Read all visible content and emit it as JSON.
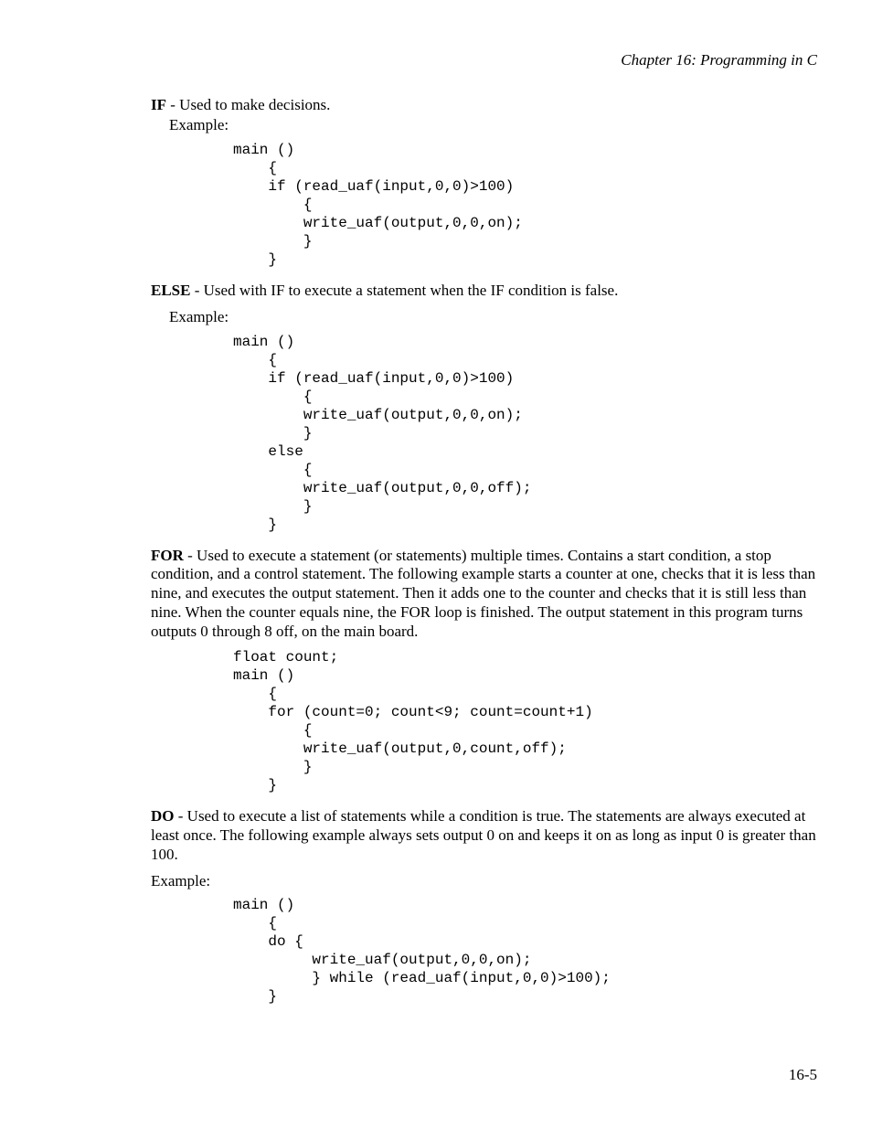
{
  "header": "Chapter 16: Programming in C",
  "if": {
    "kw": "IF",
    "desc": " - Used to make decisions.",
    "example_label": "Example:",
    "code": "main ()\n    {\n    if (read_uaf(input,0,0)>100)\n        {\n        write_uaf(output,0,0,on);\n        }\n    }"
  },
  "else": {
    "kw": "ELSE",
    "desc": " - Used with IF to execute a statement when the IF condition is false.",
    "example_label": "Example:",
    "code": "main ()\n    {\n    if (read_uaf(input,0,0)>100)\n        {\n        write_uaf(output,0,0,on);\n        }\n    else\n        {\n        write_uaf(output,0,0,off);\n        }\n    }"
  },
  "for": {
    "kw": "FOR",
    "desc": " - Used to execute a statement (or statements) multiple times.  Contains a start condition, a stop condition, and a control statement. The following example starts a counter at one, checks that it is less than nine, and executes the output statement. Then it adds one to the counter and checks that it is still less than nine. When the counter equals nine, the FOR loop is finished. The output statement in this program turns outputs 0 through 8 off, on the main board.",
    "code": "float count;\nmain ()\n    {\n    for (count=0; count<9; count=count+1)\n        {\n        write_uaf(output,0,count,off);\n        }\n    }"
  },
  "do": {
    "kw": "DO",
    "desc": " - Used to execute a list of statements while a condition is true. The statements are always executed at least once. The following example always sets output 0 on and keeps it on as long as input 0 is greater than 100.",
    "example_label": "Example:",
    "code": "main ()\n    {\n    do {\n         write_uaf(output,0,0,on);\n         } while (read_uaf(input,0,0)>100);\n    }"
  },
  "page_number": "16-5"
}
